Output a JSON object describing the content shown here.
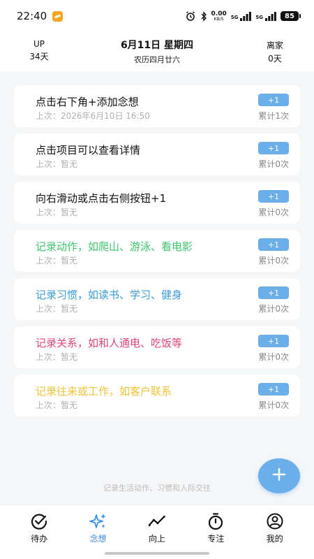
{
  "status_bar": {
    "time": "22:40",
    "net_speed_value": "0.00",
    "net_speed_unit": "KB/S",
    "signal1_label": "5G",
    "signal2_label": "5G",
    "battery": "85",
    "icons": [
      "app-badge-icon",
      "alarm-icon",
      "bluetooth-icon",
      "signal-icon",
      "battery-icon"
    ]
  },
  "header": {
    "up_label": "UP",
    "up_days": "34天",
    "date": "6月11日  星期四",
    "lunar": "农历四月廿六",
    "away_label": "离家",
    "away_days": "0天"
  },
  "cards": [
    {
      "title": "点击右下角+添加念想",
      "last": "上次：2026年6月10日 16:50",
      "count": "累计1次",
      "plus": "+1",
      "color": "#111111"
    },
    {
      "title": "点击项目可以查看详情",
      "last": "上次：暂无",
      "count": "累计0次",
      "plus": "+1",
      "color": "#111111"
    },
    {
      "title": "向右滑动或点击右侧按钮+1",
      "last": "上次：暂无",
      "count": "累计0次",
      "plus": "+1",
      "color": "#111111"
    },
    {
      "title": "记录动作，如爬山、游泳、看电影",
      "last": "上次：暂无",
      "count": "累计0次",
      "plus": "+1",
      "color": "#3ec46d"
    },
    {
      "title": "记录习惯，如读书、学习、健身",
      "last": "上次：暂无",
      "count": "累计0次",
      "plus": "+1",
      "color": "#3b9ad9"
    },
    {
      "title": "记录关系，如和人通电、吃饭等",
      "last": "上次：暂无",
      "count": "累计0次",
      "plus": "+1",
      "color": "#e0457b"
    },
    {
      "title": "记录往来或工作，如客户联系",
      "last": "上次：暂无",
      "count": "累计0次",
      "plus": "+1",
      "color": "#f0c23a"
    }
  ],
  "hint": "记录生活动作、习惯和人际交往",
  "fab": {
    "icon": "plus-icon"
  },
  "nav": [
    {
      "label": "待办",
      "icon": "check-circle-icon",
      "active": false
    },
    {
      "label": "念想",
      "icon": "sparkle-icon",
      "active": true
    },
    {
      "label": "向上",
      "icon": "trend-line-icon",
      "active": false
    },
    {
      "label": "专注",
      "icon": "stopwatch-icon",
      "active": false
    },
    {
      "label": "我的",
      "icon": "profile-icon",
      "active": false
    }
  ],
  "colors": {
    "accent": "#6aaeea",
    "nav_active": "#3d8ee6"
  }
}
